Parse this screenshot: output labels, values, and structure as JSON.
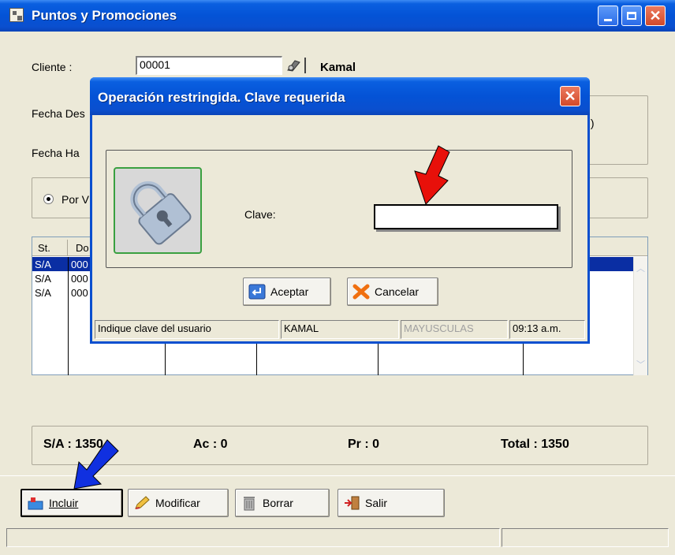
{
  "window": {
    "title": "Puntos y Promociones"
  },
  "form": {
    "cliente_label": "Cliente :",
    "cliente_value": "00001",
    "cliente_name": "Kamal",
    "fecha_desde_label": "Fecha Des",
    "fecha_hasta_label": "Fecha Ha",
    "radio_label": "Por V",
    "right_group_suffix": ":)"
  },
  "grid": {
    "headers": [
      "St.",
      "Do"
    ],
    "rows": [
      [
        "S/A",
        "000"
      ],
      [
        "S/A",
        "000"
      ],
      [
        "S/A",
        "000"
      ]
    ]
  },
  "totals": {
    "sa": "S/A : 1350",
    "ac": "Ac : 0",
    "pr": "Pr : 0",
    "total": "Total : 1350"
  },
  "buttons": {
    "incluir": "Incluir",
    "modificar": "Modificar",
    "borrar": "Borrar",
    "salir": "Salir"
  },
  "dialog": {
    "title": "Operación restringida. Clave requerida",
    "clave_label": "Clave:",
    "clave_value": "",
    "aceptar": "Aceptar",
    "cancelar": "Cancelar",
    "status": [
      "Indique clave del usuario",
      "KAMAL",
      "MAYUSCULAS",
      "09:13 a.m."
    ]
  },
  "colors": {
    "titlebar": "#0453d6",
    "selection": "#0a2ea3",
    "arrow_red": "#e8100a",
    "arrow_blue": "#1030e0"
  }
}
